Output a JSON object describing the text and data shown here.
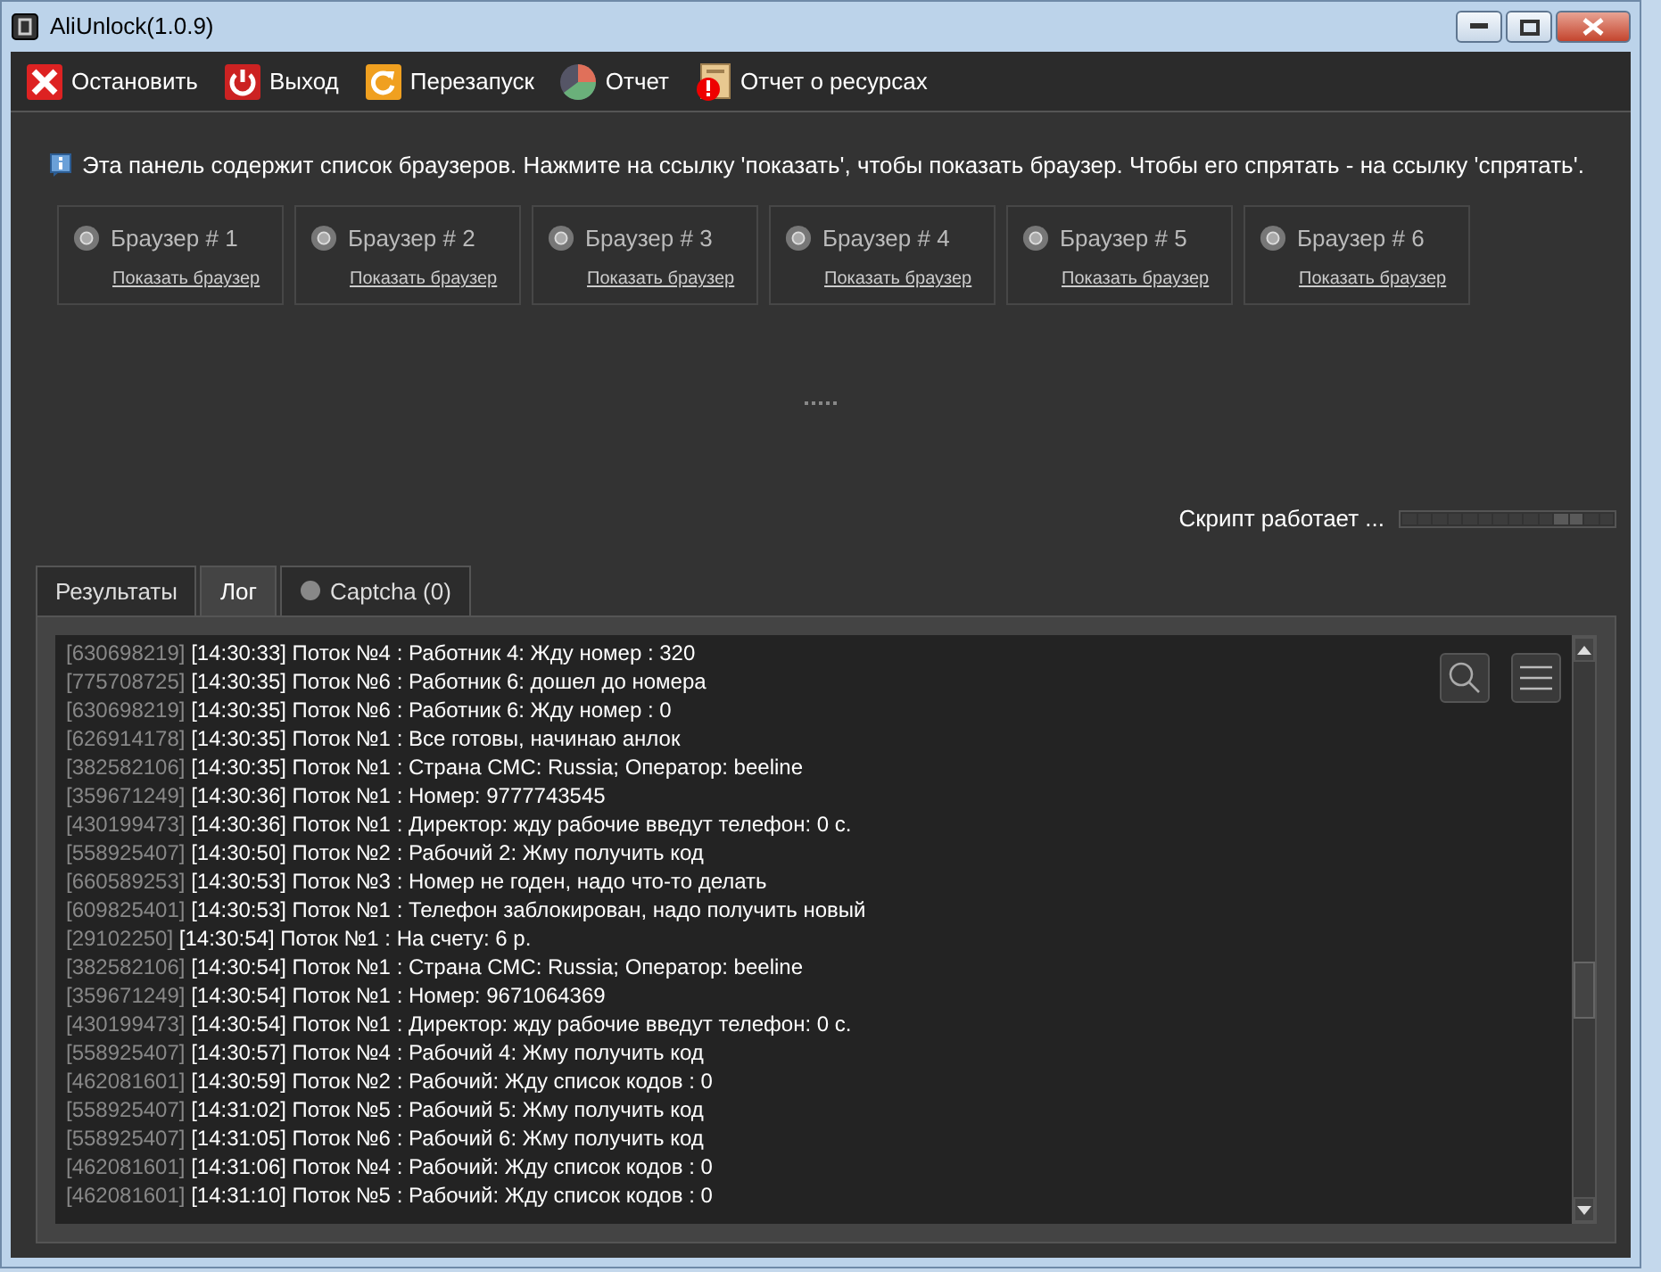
{
  "window": {
    "title": "AliUnlock(1.0.9)"
  },
  "toolbar": [
    {
      "label": "Остановить",
      "kind": "stop"
    },
    {
      "label": "Выход",
      "kind": "exit"
    },
    {
      "label": "Перезапуск",
      "kind": "restart"
    },
    {
      "label": "Отчет",
      "kind": "report"
    },
    {
      "label": "Отчет о ресурсах",
      "kind": "resources"
    }
  ],
  "info": "Эта панель содержит список браузеров. Нажмите на ссылку 'показать', чтобы показать браузер. Чтобы его спрятать - на ссылку 'спрятать'.",
  "browsers": [
    {
      "title": "Браузер # 1",
      "link": "Показать браузер"
    },
    {
      "title": "Браузер # 2",
      "link": "Показать браузер"
    },
    {
      "title": "Браузер # 3",
      "link": "Показать браузер"
    },
    {
      "title": "Браузер # 4",
      "link": "Показать браузер"
    },
    {
      "title": "Браузер # 5",
      "link": "Показать браузер"
    },
    {
      "title": "Браузер # 6",
      "link": "Показать браузер"
    }
  ],
  "status": "Скрипт работает ...",
  "tabs": [
    {
      "label": "Результаты",
      "selected": false
    },
    {
      "label": "Лог",
      "selected": true
    },
    {
      "label": "Captcha (0)",
      "selected": false,
      "kind": "dot"
    }
  ],
  "log": [
    {
      "id": "[630698219]",
      "text": "[14:30:33] Поток №4 : Работник 4: Жду номер : 320"
    },
    {
      "id": "[775708725]",
      "text": "[14:30:35] Поток №6 : Работник 6: дошел до номера"
    },
    {
      "id": "[630698219]",
      "text": "[14:30:35] Поток №6 : Работник 6: Жду номер : 0"
    },
    {
      "id": "[626914178]",
      "text": "[14:30:35] Поток №1 : Все готовы, начинаю анлок"
    },
    {
      "id": "[382582106]",
      "text": "[14:30:35] Поток №1 : Страна СМС: Russia; Оператор: beeline"
    },
    {
      "id": "[359671249]",
      "text": "[14:30:36] Поток №1 : Номер: 9777743545"
    },
    {
      "id": "[430199473]",
      "text": "[14:30:36] Поток №1 : Директор: жду рабочие введут телефон: 0 с."
    },
    {
      "id": "[558925407]",
      "text": "[14:30:50] Поток №2 : Рабочий 2: Жму получить код"
    },
    {
      "id": "[660589253]",
      "text": "[14:30:53] Поток №3 : Номер не годен, надо что-то делать"
    },
    {
      "id": "[609825401]",
      "text": "[14:30:53] Поток №1 : Телефон заблокирован, надо получить новый"
    },
    {
      "id": "[29102250]",
      "text": "[14:30:54] Поток №1 : На счету: 6 р."
    },
    {
      "id": "[382582106]",
      "text": "[14:30:54] Поток №1 : Страна СМС: Russia; Оператор: beeline"
    },
    {
      "id": "[359671249]",
      "text": "[14:30:54] Поток №1 : Номер: 9671064369"
    },
    {
      "id": "[430199473]",
      "text": "[14:30:54] Поток №1 : Директор: жду рабочие введут телефон: 0 с."
    },
    {
      "id": "[558925407]",
      "text": "[14:30:57] Поток №4 : Рабочий 4: Жму получить код"
    },
    {
      "id": "[462081601]",
      "text": "[14:30:59] Поток №2 : Рабочий: Жду список кодов : 0"
    },
    {
      "id": "[558925407]",
      "text": "[14:31:02] Поток №5 : Рабочий 5: Жму получить код"
    },
    {
      "id": "[558925407]",
      "text": "[14:31:05] Поток №6 : Рабочий 6: Жму получить код"
    },
    {
      "id": "[462081601]",
      "text": "[14:31:06] Поток №4 : Рабочий: Жду список кодов : 0"
    },
    {
      "id": "[462081601]",
      "text": "[14:31:10] Поток №5 : Рабочий: Жду список кодов : 0"
    }
  ]
}
